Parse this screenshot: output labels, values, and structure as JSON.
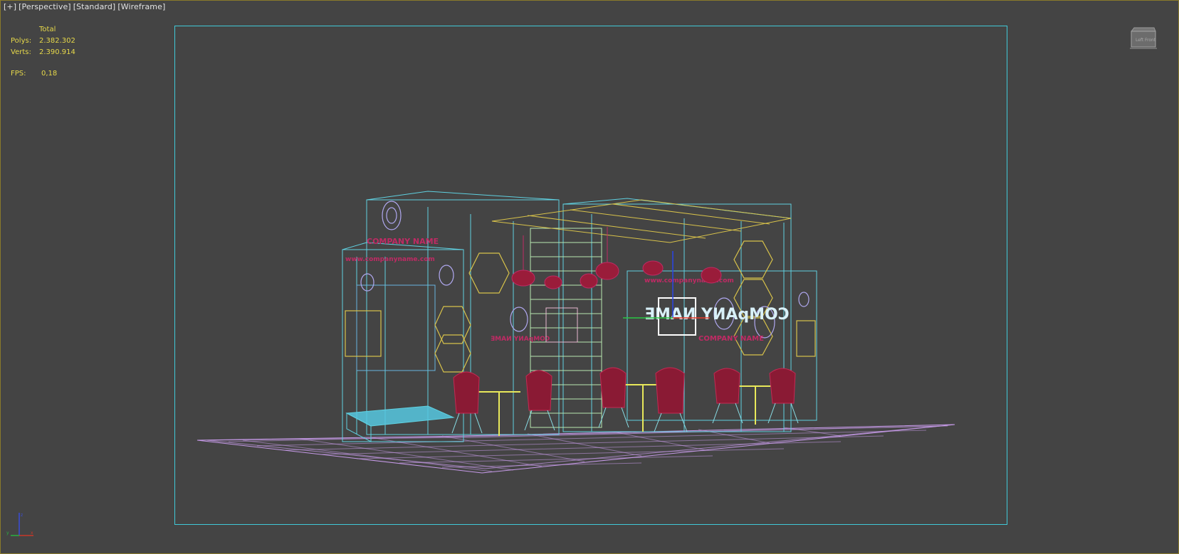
{
  "viewport": {
    "labels": [
      "[+]",
      "[Perspective]",
      "[Standard]",
      "[Wireframe]"
    ]
  },
  "stats": {
    "header": "Total",
    "polys_label": "Polys:",
    "polys_value": "2.382.302",
    "verts_label": "Verts:",
    "verts_value": "2.390.914",
    "fps_label": "FPS:",
    "fps_value": "0,18"
  },
  "viewcube": {
    "left_label": "Left",
    "front_label": "Front"
  },
  "scene": {
    "sign_text": "COMPANY NAME",
    "mirrored_text": "ƎMAИ YИAqMOƆ",
    "url_text": "www.companyname.com"
  },
  "axis_gizmo": {
    "x": "x",
    "y": "y",
    "z": "z"
  },
  "colors": {
    "background": "#444444",
    "stats_text": "#e6d84a",
    "safe_frame": "#40c9d8",
    "floor_wire": "#c69ae8",
    "structure_wire": "#5fd0e0",
    "chair": "#9a1c3a",
    "accent_yellow": "#d8c24a"
  }
}
